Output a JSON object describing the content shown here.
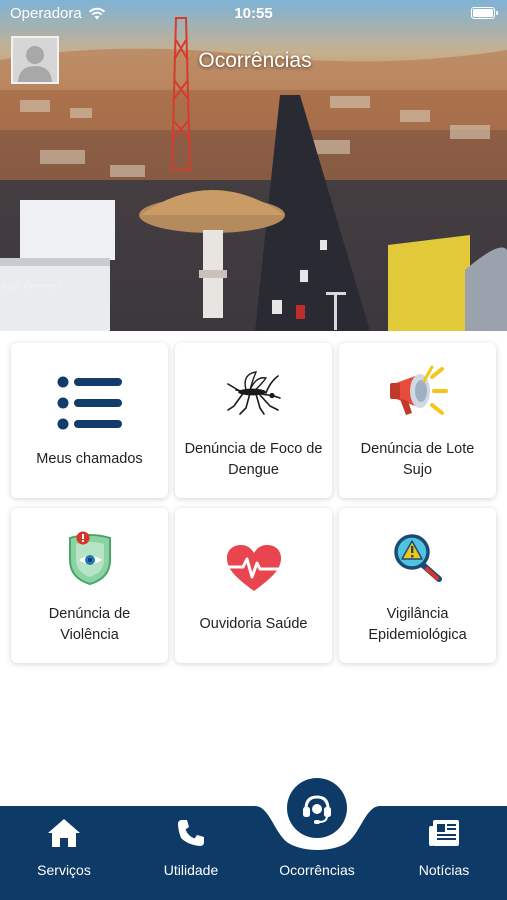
{
  "status_bar": {
    "carrier": "Operadora",
    "time": "10:55"
  },
  "header": {
    "title": "Ocorrências",
    "avatar_icon": "user-avatar-icon",
    "photo_credit": "ano Ferroni"
  },
  "cards": [
    {
      "label": "Meus chamados",
      "icon": "list-icon"
    },
    {
      "label": "Denúncia de Foco de Dengue",
      "icon": "mosquito-icon"
    },
    {
      "label": "Denúncia de Lote Sujo",
      "icon": "megaphone-icon"
    },
    {
      "label": "Denúncia de Violência",
      "icon": "shield-alert-icon"
    },
    {
      "label": "Ouvidoria Saúde",
      "icon": "heartbeat-icon"
    },
    {
      "label": "Vigilância Epidemiológica",
      "icon": "magnifier-warning-icon"
    }
  ],
  "bottom_nav": {
    "items": [
      {
        "label": "Serviços",
        "icon": "home-icon"
      },
      {
        "label": "Utilidade",
        "icon": "phone-icon"
      },
      {
        "label": "Ocorrências",
        "icon": "headset-icon",
        "active": true
      },
      {
        "label": "Notícias",
        "icon": "newspaper-icon"
      }
    ]
  },
  "colors": {
    "nav_background": "#0d3a67",
    "primary_dark": "#123c6b",
    "card_text": "#222222"
  }
}
